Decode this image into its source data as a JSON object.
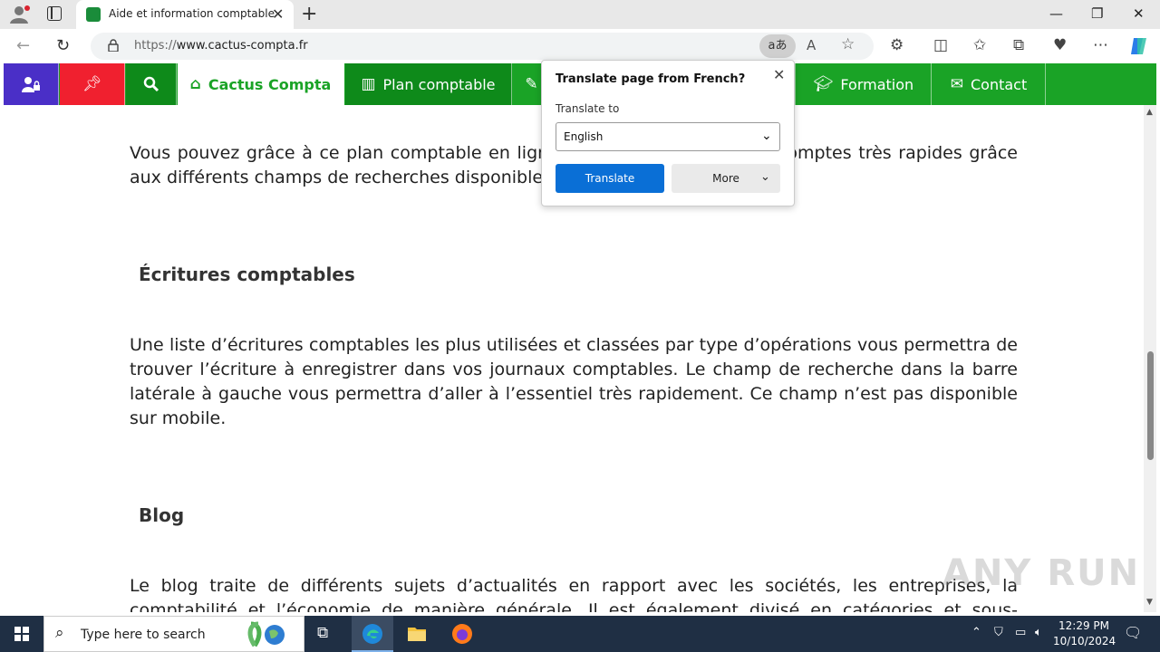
{
  "browser": {
    "tab_title": "Aide et information comptable",
    "url_proto": "https://",
    "url_host": "www.cactus-compta.fr",
    "translate_pill": "aあ"
  },
  "site_nav": {
    "items": [
      {
        "label": "",
        "icon": "user-lock-icon",
        "bg": "#4a2fc7"
      },
      {
        "label": "",
        "icon": "thumbtack-icon",
        "bg": "#f0202f"
      },
      {
        "label": "",
        "icon": "search-icon",
        "bg": "#0e8a1a"
      },
      {
        "label": "Cactus Compta",
        "icon": "home-icon"
      },
      {
        "label": "Plan comptable",
        "icon": "map-icon"
      },
      {
        "label": "Formation",
        "icon": "graduation-cap-icon"
      },
      {
        "label": "Contact",
        "icon": "envelope-icon"
      }
    ]
  },
  "content": {
    "para1": "Vous pouvez grâce à ce plan comptable en ligne trouver les numéros de comptes très rapides grâce aux différents champs de recherches disponibles.",
    "heading1": "Écritures comptables",
    "para2": "Une liste d’écritures comptables les plus utilisées et classées par type d’opérations vous permettra de trouver l’écriture à enregistrer dans vos journaux comptables. Le champ de recherche dans la barre latérale à gauche vous permettra d’aller à l’essentiel très rapidement. Ce champ n’est pas disponible sur mobile.",
    "heading2": "Blog",
    "para3": "Le blog traite de différents sujets d’actualités en rapport avec les sociétés, les entreprises, la comptabilité et l’économie de manière générale. Il est également divisé en catégories et sous-catégories."
  },
  "translate_popup": {
    "title": "Translate page from French?",
    "label": "Translate to",
    "selected_language": "English",
    "translate_button": "Translate",
    "more_button": "More"
  },
  "watermark": "ANY RUN",
  "taskbar": {
    "search_placeholder": "Type here to search",
    "time": "12:29 PM",
    "date": "10/10/2024"
  }
}
